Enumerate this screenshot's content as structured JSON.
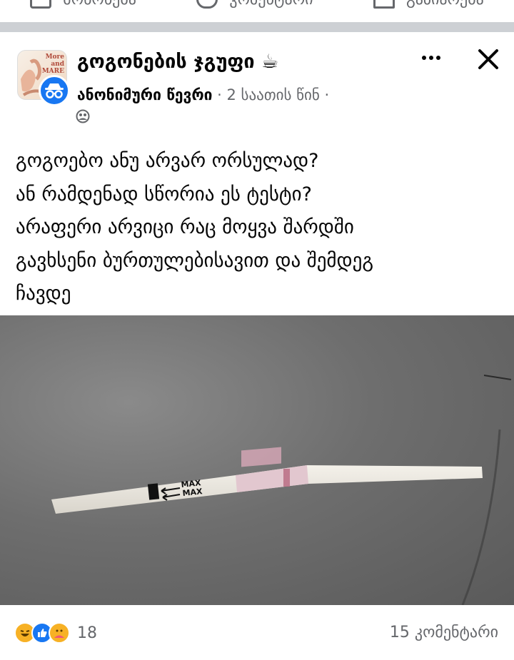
{
  "previous_post_actions": {
    "like_label": "მოწონება",
    "comment_label": "კომენტარი",
    "share_label": "გაზიარება"
  },
  "post": {
    "group_name": "გოგონების ჯგუფი ☕",
    "author": "ანონიმური წევრი",
    "timestamp": "· 2 საათის წინ ·",
    "text": "გოგოებო ანუ არვარ ორსულად?\nან რამდენად სწორია ეს ტესტი?\n არაფერი არვიცი რაც მოყვა შარდში\nგავხსენი ბურთულებისავით და შემდეგ\nჩავდე",
    "photo": {
      "strip_label_top": "MAX",
      "strip_label_bottom": "MAX"
    }
  },
  "engagement": {
    "reaction_count": "18",
    "comments": "15 კომენტარი",
    "reactions": [
      "haha",
      "like",
      "care"
    ]
  },
  "colors": {
    "brand_blue": "#1877f2",
    "separator": "#cdd0d4",
    "secondary_text": "#65676b"
  },
  "icons": {
    "group_avatar": "group-photo-avatar",
    "user_avatar": "anonymous-member-icon",
    "audience": "group-members-icon",
    "more": "more-dots-icon",
    "close": "close-icon"
  }
}
